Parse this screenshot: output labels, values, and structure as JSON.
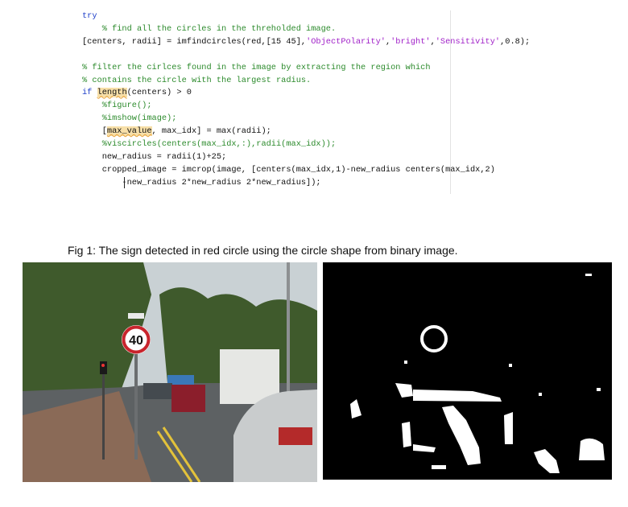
{
  "code": {
    "lines": [
      {
        "seg": [
          {
            "t": "try",
            "c": "kw"
          }
        ]
      },
      {
        "seg": [
          {
            "t": "    % find all the circles in the threholded image.",
            "c": "cm"
          }
        ]
      },
      {
        "seg": [
          {
            "t": "[centers, radii] = imfindcircles(red,[15 45],"
          },
          {
            "t": "'ObjectPolarity'",
            "c": "st"
          },
          {
            "t": ","
          },
          {
            "t": "'bright'",
            "c": "st"
          },
          {
            "t": ","
          },
          {
            "t": "'Sensitivity'",
            "c": "st"
          },
          {
            "t": ",0.8);"
          }
        ]
      },
      {
        "seg": []
      },
      {
        "seg": [
          {
            "t": "% filter the cirlces found in the image by extracting the region which",
            "c": "cm"
          }
        ]
      },
      {
        "seg": [
          {
            "t": "% contains the circle with the largest radius.",
            "c": "cm"
          }
        ]
      },
      {
        "seg": [
          {
            "t": "if ",
            "c": "kw"
          },
          {
            "t": "length",
            "c": "hl sq"
          },
          {
            "t": "(centers) > 0"
          }
        ]
      },
      {
        "seg": [
          {
            "t": "    "
          },
          {
            "t": "%figure();",
            "c": "cm"
          }
        ]
      },
      {
        "seg": [
          {
            "t": "    "
          },
          {
            "t": "%imshow(image);",
            "c": "cm"
          }
        ]
      },
      {
        "seg": [
          {
            "t": "    ["
          },
          {
            "t": "max_value",
            "c": "hl sq"
          },
          {
            "t": ", max_idx] = max(radii);"
          }
        ]
      },
      {
        "seg": [
          {
            "t": "    "
          },
          {
            "t": "%viscircles(centers(max_idx,:),radii(max_idx));",
            "c": "cm"
          }
        ]
      },
      {
        "seg": [
          {
            "t": "    new_radius = radii(1)+25;"
          }
        ]
      },
      {
        "seg": [
          {
            "t": "    cropped_image = imcrop(image, [centers(max_idx,1)-new_radius centers(max_idx,2)"
          }
        ]
      },
      {
        "seg": [
          {
            "t": "        -new_radius 2*new_radius 2*new_radius]);"
          }
        ]
      }
    ]
  },
  "caption": "Fig 1: The sign detected in red circle using the circle shape from binary image.",
  "photo": {
    "sign_text": "40",
    "colors": {
      "sign_red": "#c8242c",
      "sky": "#c9d1d4",
      "foliage": "#3f5a2c",
      "road": "#5d6163",
      "car_silver": "#c9cccd",
      "truck": "#e6e7e4"
    }
  },
  "binary": {
    "colors": {
      "background": "#000000",
      "foreground": "#ffffff"
    }
  }
}
